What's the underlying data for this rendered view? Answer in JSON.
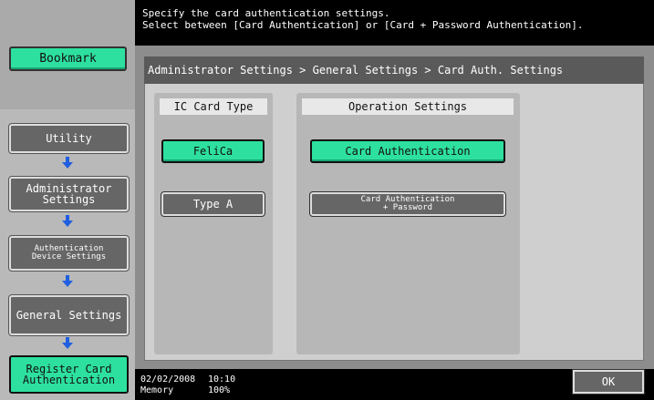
{
  "header": {
    "message": "Specify the card authentication settings.\nSelect between [Card Authentication] or [Card + Password Authentication]."
  },
  "sidebar": {
    "bookmark_label": "Bookmark",
    "items": [
      {
        "label": "Utility"
      },
      {
        "label": "Administrator\nSettings"
      },
      {
        "label": "Authentication\nDevice Settings"
      },
      {
        "label": "General Settings"
      },
      {
        "label": "Register Card\nAuthentication"
      }
    ]
  },
  "breadcrumb": "Administrator Settings > General Settings > Card Auth. Settings",
  "ic_card": {
    "title": "IC Card Type",
    "options": [
      {
        "label": "FeliCa",
        "selected": true
      },
      {
        "label": "Type A",
        "selected": false
      }
    ]
  },
  "operation": {
    "title": "Operation Settings",
    "options": [
      {
        "label": "Card Authentication",
        "selected": true
      },
      {
        "label": "Card Authentication\n+ Password",
        "selected": false
      }
    ]
  },
  "footer": {
    "date": "02/02/2008",
    "time": "10:10",
    "memory_label": "Memory",
    "memory_value": "100%",
    "ok_label": "OK"
  },
  "colors": {
    "accent": "#2ee0a0",
    "button_gray": "#666666",
    "arrow_blue": "#1f5fe0"
  }
}
